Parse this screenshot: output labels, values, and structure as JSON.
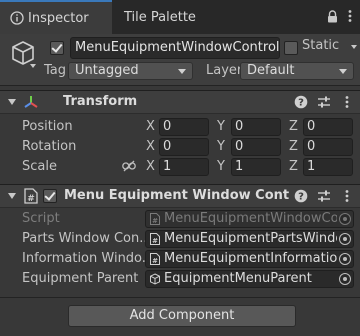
{
  "tabs": {
    "inspector": "Inspector",
    "tile_palette": "Tile Palette"
  },
  "header": {
    "object_name": "MenuEquipmentWindowController",
    "active_checked": true,
    "static_label": "Static",
    "static_checked": false,
    "tag_label": "Tag",
    "tag_value": "Untagged",
    "layer_label": "Layer",
    "layer_value": "Default"
  },
  "transform": {
    "title": "Transform",
    "axes": {
      "x": "X",
      "y": "Y",
      "z": "Z"
    },
    "position": {
      "label": "Position",
      "x": "0",
      "y": "0",
      "z": "0"
    },
    "rotation": {
      "label": "Rotation",
      "x": "0",
      "y": "0",
      "z": "0"
    },
    "scale": {
      "label": "Scale",
      "x": "1",
      "y": "1",
      "z": "1"
    }
  },
  "script_component": {
    "title": "Menu Equipment Window Controller (Sc",
    "enabled": true,
    "fields": [
      {
        "label": "Script",
        "value": "MenuEquipmentWindowContro",
        "disabled": true
      },
      {
        "label": "Parts Window Con...",
        "value": "MenuEquipmentPartsWindowC"
      },
      {
        "label": "Information Windo...",
        "value": "MenuEquipmentInformationWir"
      },
      {
        "label": "Equipment Parent",
        "value": "EquipmentMenuParent"
      }
    ]
  },
  "add_component_label": "Add Component",
  "colors": {
    "accent": "#3a79bb",
    "background": "#383838",
    "field": "#2a2a2a"
  }
}
